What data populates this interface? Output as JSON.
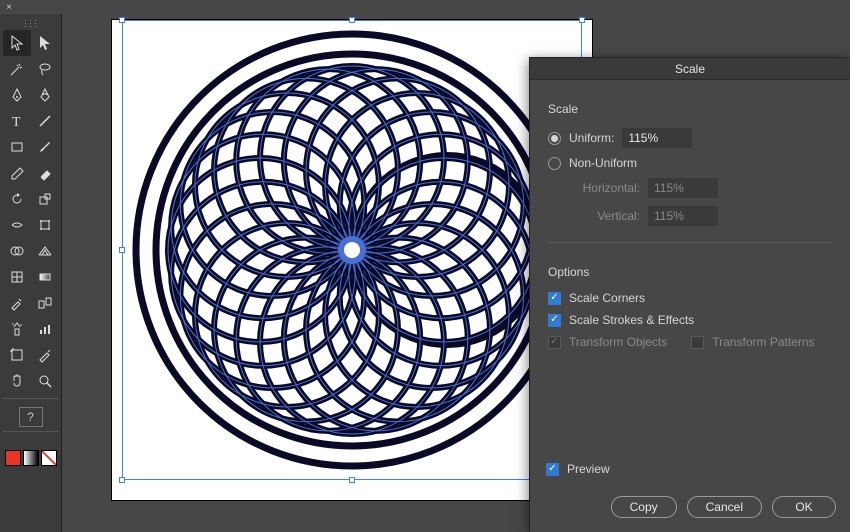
{
  "dialog": {
    "title": "Scale",
    "scale_section": "Scale",
    "uniform_label": "Uniform:",
    "uniform_value": "115%",
    "nonuniform_label": "Non-Uniform",
    "horizontal_label": "Horizontal:",
    "horizontal_value": "115%",
    "vertical_label": "Vertical:",
    "vertical_value": "115%",
    "options_section": "Options",
    "scale_corners": "Scale Corners",
    "scale_strokes": "Scale Strokes & Effects",
    "transform_objects": "Transform Objects",
    "transform_patterns": "Transform Patterns",
    "preview": "Preview",
    "copy": "Copy",
    "cancel": "Cancel",
    "ok": "OK"
  },
  "tools": {
    "question": "?",
    "close": "×"
  }
}
